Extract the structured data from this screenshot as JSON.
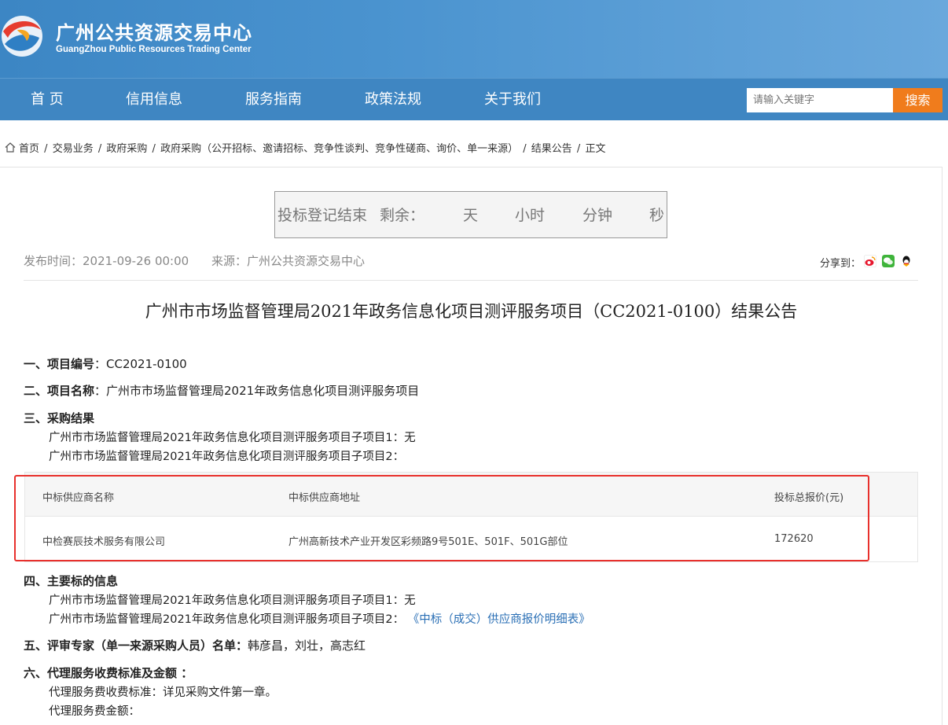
{
  "header": {
    "title": "广州公共资源交易中心",
    "subtitle": "GuangZhou Public Resources Trading Center"
  },
  "nav": {
    "items": [
      "首 页",
      "信用信息",
      "服务指南",
      "政策法规",
      "关于我们"
    ],
    "search_placeholder": "请输入关键字",
    "search_button": "搜索"
  },
  "breadcrumb": [
    "首页",
    "/",
    "交易业务",
    "/",
    "政府采购",
    "/",
    "政府采购（公开招标、邀请招标、竞争性谈判、竞争性磋商、询价、单一来源）",
    "/",
    "结果公告",
    "/",
    "正文"
  ],
  "countdown": {
    "label": "投标登记结束",
    "remaining": "剩余：",
    "day": "天",
    "hour": "小时",
    "minute": "分钟",
    "second": "秒"
  },
  "meta": {
    "publish_time": "发布时间：2021-09-26 00:00",
    "source": "来源：广州公共资源交易中心",
    "share_label": "分享到："
  },
  "article": {
    "title": "广州市市场监督管理局2021年政务信息化项目测评服务项目（CC2021-0100）结果公告",
    "s1_label": "一、项目编号",
    "s1_value": "：CC2021-0100",
    "s2_label": "二、项目名称",
    "s2_value": "：广州市市场监督管理局2021年政务信息化项目测评服务项目",
    "s3_label": "三、采购结果",
    "s3_line1": "广州市市场监督管理局2021年政务信息化项目测评服务项目子项目1：无",
    "s3_line2": "广州市市场监督管理局2021年政务信息化项目测评服务项目子项目2：",
    "s4_label": "四、主要标的信息",
    "s4_line1": "广州市市场监督管理局2021年政务信息化项目测评服务项目子项目1：无",
    "s4_line2": "广州市市场监督管理局2021年政务信息化项目测评服务项目子项目2：",
    "s4_link": "《中标（成交）供应商报价明细表》",
    "s5_label": "五、评审专家（单一来源采购人员）名单：",
    "s5_value": "韩彦昌，刘壮，高志红",
    "s6_label": "六、代理服务收费标准及金额 ：",
    "s6_line1": "代理服务费收费标准：详见采购文件第一章。",
    "s6_line2": "代理服务费金额："
  },
  "table": {
    "headers": [
      "中标供应商名称",
      "中标供应商地址",
      "投标总报价(元)"
    ],
    "rows": [
      [
        "中检赛辰技术服务有限公司",
        "广州高新技术产业开发区彩频路9号501E、501F、501G部位",
        "172620"
      ]
    ]
  },
  "colors": {
    "header_blue": "#3c86c4",
    "search_orange": "#f07c1c",
    "highlight_red": "#e8302c",
    "link_blue": "#2a6fb5"
  }
}
